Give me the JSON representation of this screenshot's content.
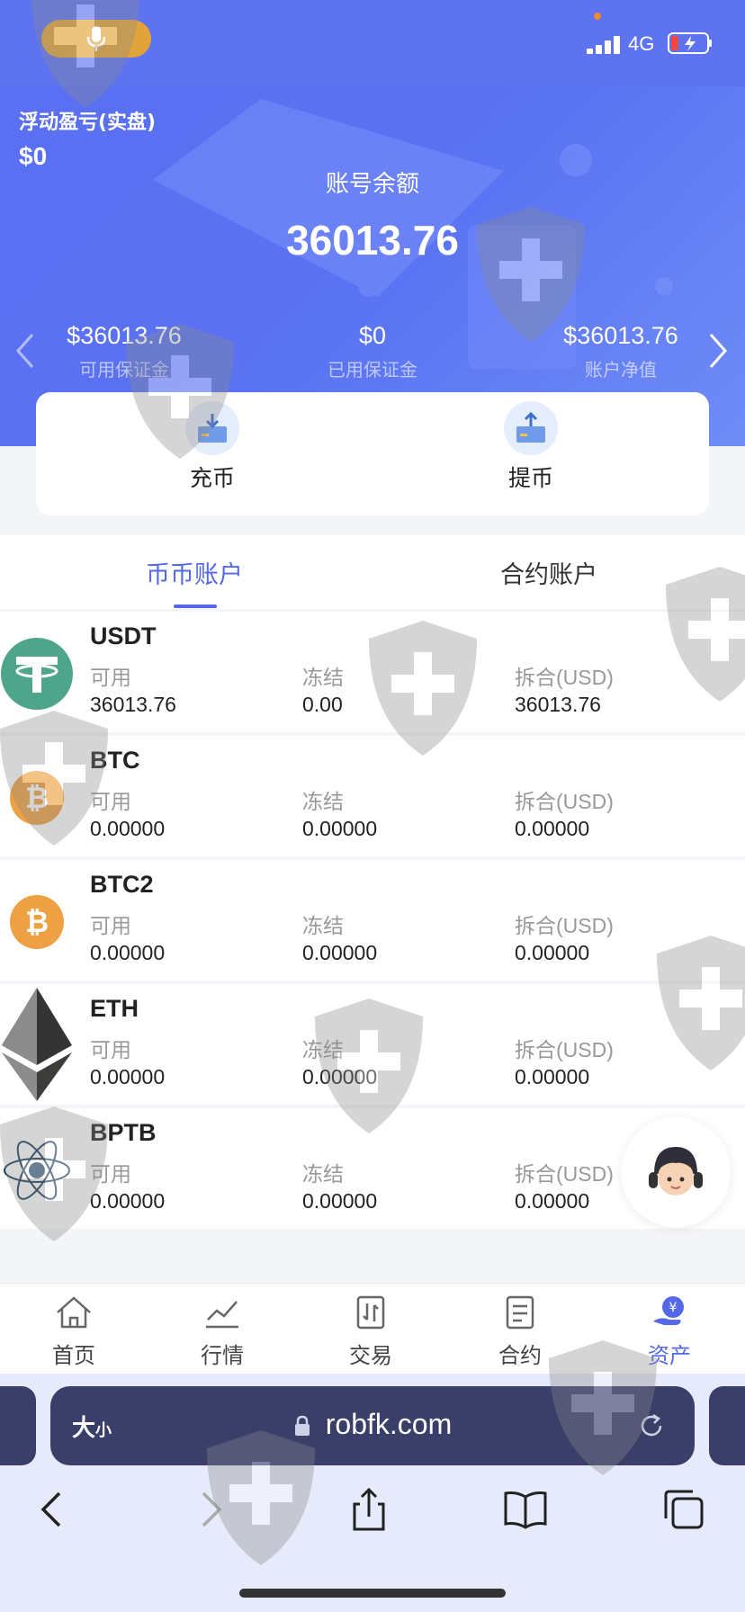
{
  "status_bar": {
    "network": "4G"
  },
  "header": {
    "pnl_label": "浮动盈亏(实盘)",
    "pnl_value": "$0",
    "balance_label": "账号余额",
    "balance_value": "36013.76",
    "stats": [
      {
        "value": "$36013.76",
        "label": "可用保证金"
      },
      {
        "value": "$0",
        "label": "已用保证金"
      },
      {
        "value": "$36013.76",
        "label": "账户净值"
      }
    ]
  },
  "actions": {
    "deposit": "充币",
    "withdraw": "提币"
  },
  "tabs": [
    {
      "label": "币币账户",
      "active": true
    },
    {
      "label": "合约账户",
      "active": false
    }
  ],
  "columns": {
    "available": "可用",
    "frozen": "冻结",
    "converted": "拆合(USD)"
  },
  "assets": [
    {
      "name": "USDT",
      "available": "36013.76",
      "frozen": "0.00",
      "converted": "36013.76",
      "icon": "tether-icon"
    },
    {
      "name": "BTC",
      "available": "0.00000",
      "frozen": "0.00000",
      "converted": "0.00000",
      "icon": "bitcoin-icon"
    },
    {
      "name": "BTC2",
      "available": "0.00000",
      "frozen": "0.00000",
      "converted": "0.00000",
      "icon": "bitcoin-icon"
    },
    {
      "name": "ETH",
      "available": "0.00000",
      "frozen": "0.00000",
      "converted": "0.00000",
      "icon": "ethereum-icon"
    },
    {
      "name": "BPTB",
      "available": "0.00000",
      "frozen": "0.00000",
      "converted": "0.00000",
      "icon": "atom-icon"
    }
  ],
  "bottom_nav": [
    {
      "label": "首页",
      "icon": "home-icon"
    },
    {
      "label": "行情",
      "icon": "chart-icon"
    },
    {
      "label": "交易",
      "icon": "trade-icon"
    },
    {
      "label": "合约",
      "icon": "contract-icon"
    },
    {
      "label": "资产",
      "icon": "assets-icon",
      "active": true
    }
  ],
  "browser": {
    "text_size": "大",
    "text_size_small": "小",
    "url": "robfk.com"
  },
  "colors": {
    "accent": "#5569e8",
    "header": "#5a6ef2",
    "tether": "#4fa58a",
    "bitcoin": "#eea143"
  }
}
